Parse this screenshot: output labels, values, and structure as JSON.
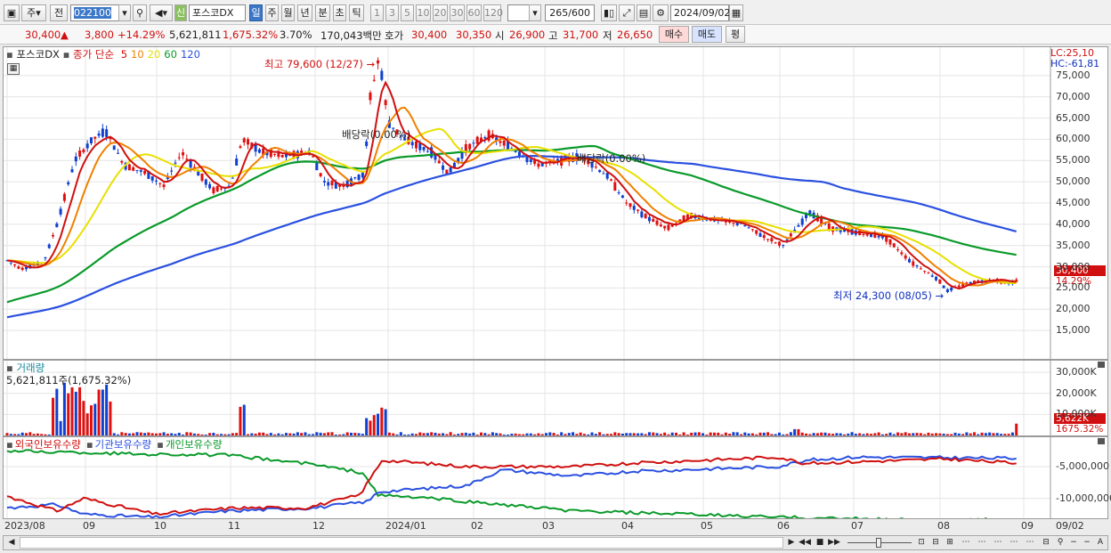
{
  "toolbar": {
    "market_type": "주",
    "prev_label": "전",
    "code": "022100",
    "stock_name": "포스코DX",
    "new_label": "신",
    "periods": [
      "일",
      "주",
      "월",
      "년",
      "분",
      "초",
      "틱"
    ],
    "minutes": [
      "1",
      "3",
      "5",
      "10",
      "20",
      "30",
      "60",
      "120"
    ],
    "count": "265",
    "count_max": "/600",
    "date": "2024/09/02"
  },
  "quote": {
    "price": "30,400",
    "arrow": "▲",
    "change": "3,800",
    "change_pct": "+14.29%",
    "volume": "5,621,811",
    "volume_pct": "1,675.32%",
    "turnover": "3.70%",
    "amount": "170,043백만",
    "ask_label": "호가",
    "ask": "30,400",
    "bid": "30,350",
    "open_label": "시",
    "open": "26,900",
    "high_label": "고",
    "high": "31,700",
    "low_label": "저",
    "low": "26,650",
    "buy": "매수",
    "sell": "매도",
    "avg": "평"
  },
  "price_panel": {
    "stock": "포스코DX",
    "legend_prefix": "종가 단순",
    "ma_labels": [
      "5",
      "10",
      "20",
      "60",
      "120"
    ],
    "ma_colors": [
      "#d01010",
      "#f08000",
      "#e8e000",
      "#0a9a2a",
      "#2a50e0"
    ],
    "lc": "LC:25,10",
    "hc": "HC:-61,81",
    "high_note": "최고 79,600 (12/27)",
    "low_note": "최저 24,300 (08/05)",
    "div_note1": "배당락(0.00%)",
    "div_note2": "배당락(0.00%)",
    "last_price": "30,400",
    "last_pct": "14.29%",
    "y_labels": [
      "75,000",
      "70,000",
      "65,000",
      "60,000",
      "55,000",
      "50,000",
      "45,000",
      "40,000",
      "35,000",
      "30,000",
      "25,000",
      "20,000",
      "15,000"
    ]
  },
  "volume_panel": {
    "title": "거래량",
    "value": "5,621,811주(1,675.32%)",
    "y_labels": [
      "30,000K",
      "20,000K",
      "10,000K"
    ],
    "last_vol": "5,622K",
    "last_pct": "1675.32%"
  },
  "holding_panel": {
    "legend": [
      "외국인보유수량",
      "기관보유수량",
      "개인보유수량"
    ],
    "legend_colors": [
      "#d01010",
      "#2a50e0",
      "#0a9a2a"
    ],
    "y_labels": [
      "-5,000,000",
      "-10,000,000"
    ]
  },
  "x_axis": [
    "2023/08",
    "09",
    "10",
    "11",
    "12",
    "2024/01",
    "02",
    "03",
    "04",
    "05",
    "06",
    "07",
    "08",
    "09"
  ],
  "x_axis_right": "09/02",
  "chart_data": {
    "type": "candlestick",
    "x": [
      "2023/08",
      "09",
      "10",
      "11",
      "12",
      "2024/01",
      "02",
      "03",
      "04",
      "05",
      "06",
      "07",
      "08",
      "09"
    ],
    "close": [
      30500,
      57000,
      48000,
      55000,
      52000,
      62000,
      59000,
      54000,
      45000,
      41000,
      39000,
      37000,
      27000,
      30400
    ],
    "high_point": {
      "value": 79600,
      "date": "12/27"
    },
    "low_point": {
      "value": 24300,
      "date": "08/05"
    },
    "last": {
      "price": 30400,
      "change_pct": 14.29,
      "volume": 5621811
    },
    "ylim": [
      15000,
      75000
    ],
    "volume_ylim_k": [
      0,
      30000
    ],
    "holdings_ylim": [
      -10000000,
      -5000000
    ]
  }
}
